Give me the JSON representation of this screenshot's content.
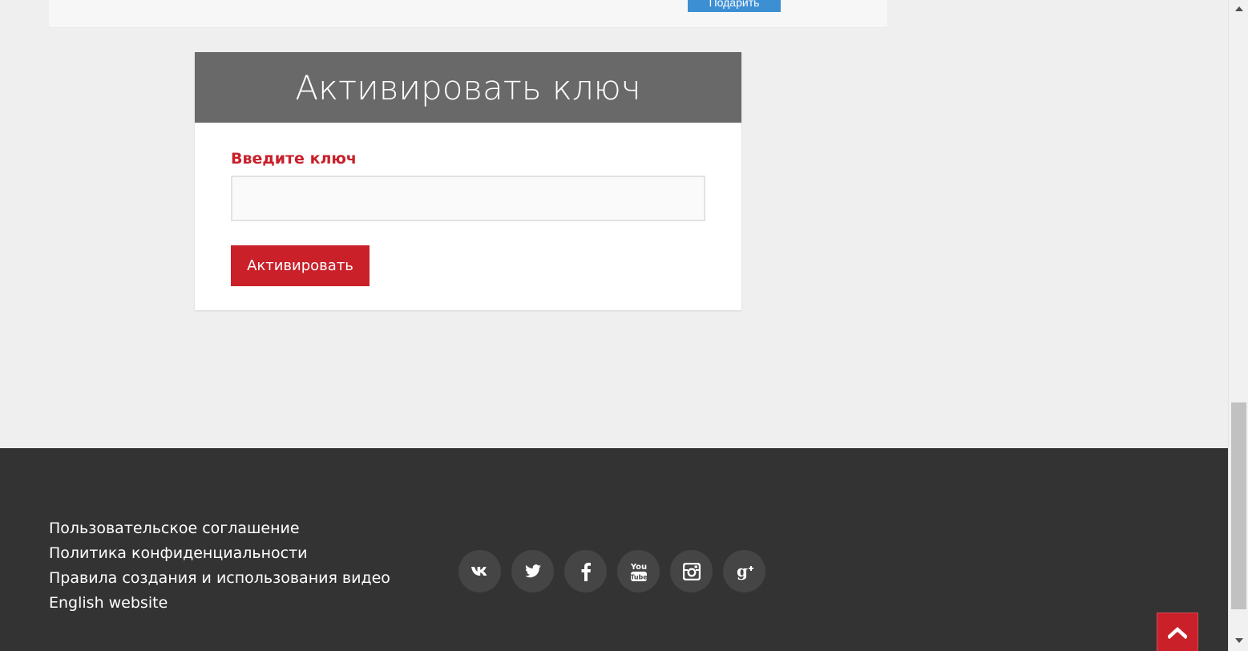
{
  "top_card": {
    "button_label": "Подарить"
  },
  "activate_card": {
    "title": "Активировать ключ",
    "field_label": "Введите ключ",
    "input_value": "",
    "button_label": "Активировать"
  },
  "footer": {
    "links": [
      "Пользовательское соглашение",
      "Политика конфиденциальности",
      "Правила создания и использования видео",
      "English website"
    ],
    "socials": [
      "vk-icon",
      "twitter-icon",
      "facebook-icon",
      "youtube-icon",
      "instagram-icon",
      "google-plus-icon"
    ],
    "scroll_top_icon": "chevron-up-icon"
  },
  "colors": {
    "accent_red": "#c9202a",
    "header_gray": "#696969",
    "footer_bg": "#333333",
    "gift_button_blue": "#3d8fd4"
  }
}
